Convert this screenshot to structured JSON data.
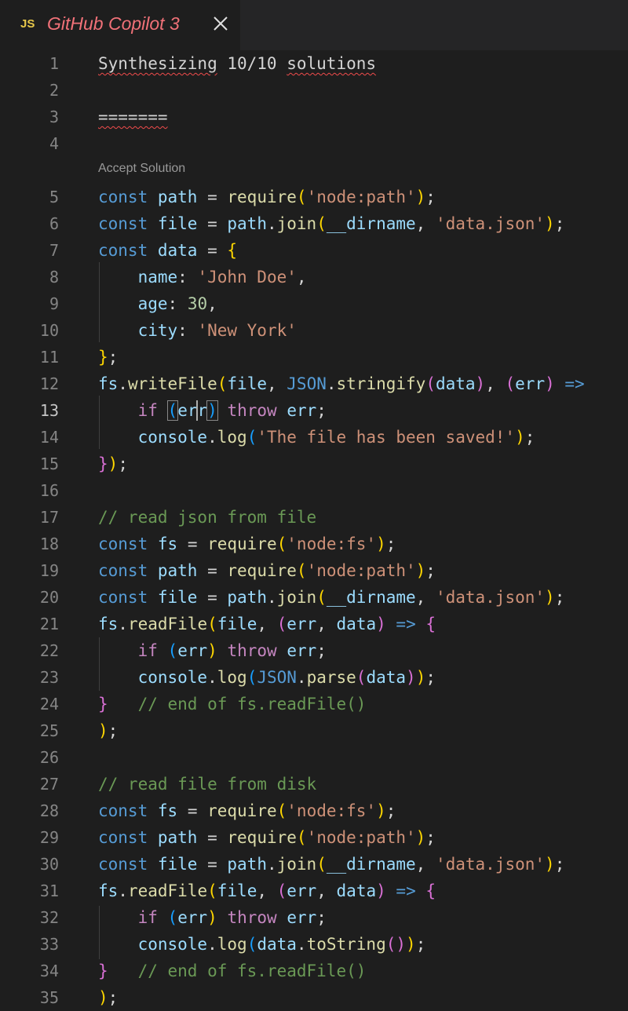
{
  "tab": {
    "lang_badge": "JS",
    "title": "GitHub Copilot 3"
  },
  "editor": {
    "codelens": "Accept Solution",
    "active_line": 13,
    "lines": [
      {
        "n": "1",
        "text": "Synthesizing 10/10 solutions"
      },
      {
        "n": "2",
        "text": ""
      },
      {
        "n": "3",
        "text": "======="
      },
      {
        "n": "4",
        "text": ""
      },
      {
        "n": "5",
        "text": "const path = require('node:path');"
      },
      {
        "n": "6",
        "text": "const file = path.join(__dirname, 'data.json');"
      },
      {
        "n": "7",
        "text": "const data = {"
      },
      {
        "n": "8",
        "text": "    name: 'John Doe',"
      },
      {
        "n": "9",
        "text": "    age: 30,"
      },
      {
        "n": "10",
        "text": "    city: 'New York'"
      },
      {
        "n": "11",
        "text": "};"
      },
      {
        "n": "12",
        "text": "fs.writeFile(file, JSON.stringify(data), (err) =>"
      },
      {
        "n": "13",
        "text": "    if (err) throw err;"
      },
      {
        "n": "14",
        "text": "    console.log('The file has been saved!');"
      },
      {
        "n": "15",
        "text": "});"
      },
      {
        "n": "16",
        "text": ""
      },
      {
        "n": "17",
        "text": "// read json from file"
      },
      {
        "n": "18",
        "text": "const fs = require('node:fs');"
      },
      {
        "n": "19",
        "text": "const path = require('node:path');"
      },
      {
        "n": "20",
        "text": "const file = path.join(__dirname, 'data.json');"
      },
      {
        "n": "21",
        "text": "fs.readFile(file, (err, data) => {"
      },
      {
        "n": "22",
        "text": "    if (err) throw err;"
      },
      {
        "n": "23",
        "text": "    console.log(JSON.parse(data));"
      },
      {
        "n": "24",
        "text": "}   // end of fs.readFile()"
      },
      {
        "n": "25",
        "text": ");"
      },
      {
        "n": "26",
        "text": ""
      },
      {
        "n": "27",
        "text": "// read file from disk"
      },
      {
        "n": "28",
        "text": "const fs = require('node:fs');"
      },
      {
        "n": "29",
        "text": "const path = require('node:path');"
      },
      {
        "n": "30",
        "text": "const file = path.join(__dirname, 'data.json');"
      },
      {
        "n": "31",
        "text": "fs.readFile(file, (err, data) => {"
      },
      {
        "n": "32",
        "text": "    if (err) throw err;"
      },
      {
        "n": "33",
        "text": "    console.log(data.toString());"
      },
      {
        "n": "34",
        "text": "}   // end of fs.readFile()"
      },
      {
        "n": "35",
        "text": ");"
      }
    ]
  },
  "colors": {
    "background": "#1e1e1e",
    "tab_title": "#f07178",
    "keyword": "#569cd6",
    "string": "#ce9178",
    "comment": "#6a9955",
    "control": "#c586c0"
  },
  "icons": {
    "close": "close-icon"
  }
}
